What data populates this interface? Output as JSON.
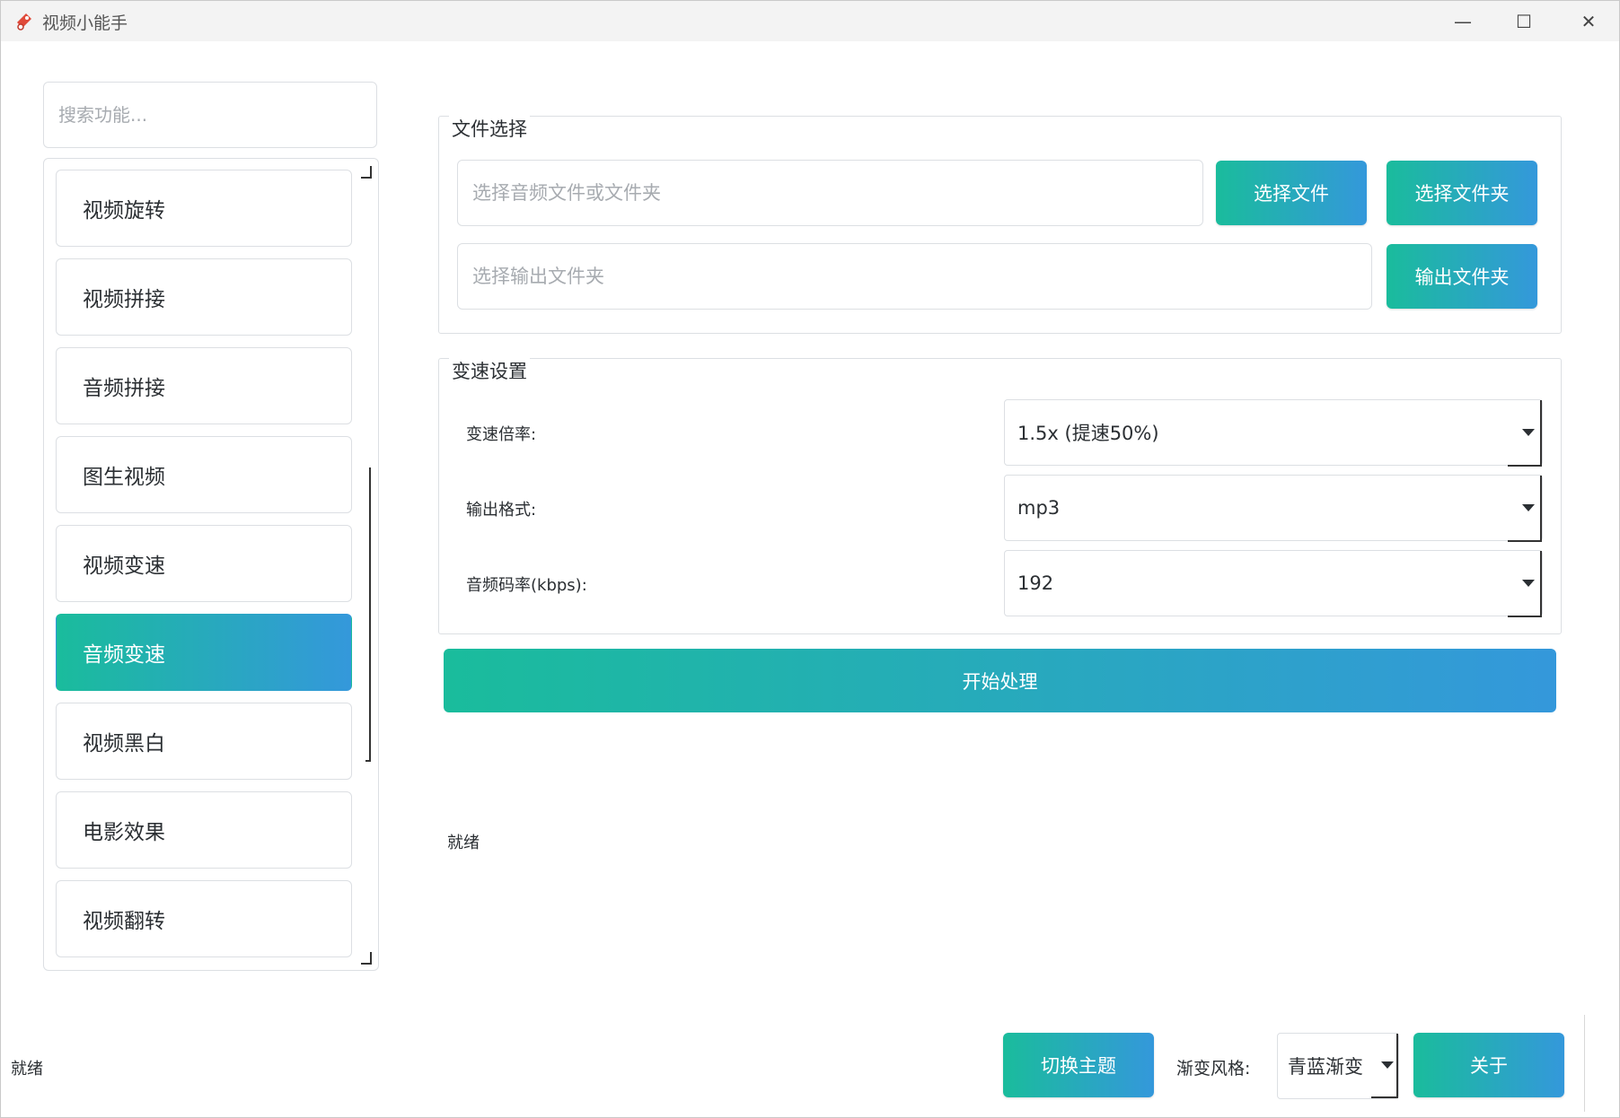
{
  "window": {
    "title": "视频小能手",
    "app_icon": "app-logo-icon",
    "controls": {
      "minimize": "—",
      "maximize": "☐",
      "close": "✕"
    }
  },
  "sidebar": {
    "search_placeholder": "搜索功能...",
    "items": [
      {
        "label": "视频旋转",
        "active": false
      },
      {
        "label": "视频拼接",
        "active": false
      },
      {
        "label": "音频拼接",
        "active": false
      },
      {
        "label": "图生视频",
        "active": false
      },
      {
        "label": "视频变速",
        "active": false
      },
      {
        "label": "音频变速",
        "active": true
      },
      {
        "label": "视频黑白",
        "active": false
      },
      {
        "label": "电影效果",
        "active": false
      },
      {
        "label": "视频翻转",
        "active": false
      }
    ]
  },
  "file_group": {
    "title": "文件选择",
    "input_placeholder": "选择音频文件或文件夹",
    "select_file_label": "选择文件",
    "select_folder_label": "选择文件夹",
    "output_placeholder": "选择输出文件夹",
    "output_folder_label": "输出文件夹"
  },
  "speed_group": {
    "title": "变速设置",
    "rate_label": "变速倍率:",
    "rate_value": "1.5x (提速50%)",
    "format_label": "输出格式:",
    "format_value": "mp3",
    "bitrate_label": "音频码率(kbps):",
    "bitrate_value": "192"
  },
  "start_button_label": "开始处理",
  "status_text": "就绪",
  "bottom_bar": {
    "status": "就绪",
    "switch_theme_label": "切换主题",
    "gradient_style_label": "渐变风格:",
    "gradient_style_value": "青蓝渐变",
    "about_label": "关于"
  },
  "colors": {
    "gradient_start": "#1abc9c",
    "gradient_end": "#3498db",
    "border": "#dcdfe3"
  }
}
